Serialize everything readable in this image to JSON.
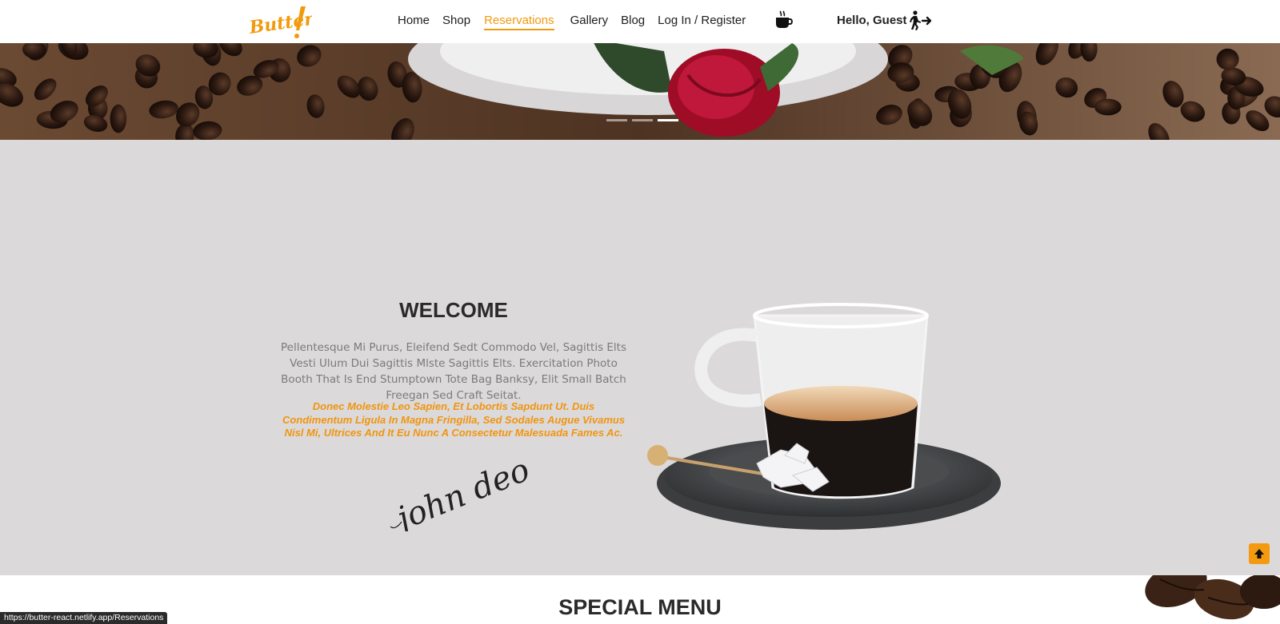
{
  "brand": {
    "logo_text": "Butter!",
    "accent_color": "#f29a0e"
  },
  "nav": {
    "items": [
      {
        "label": "Home",
        "active": false
      },
      {
        "label": "Shop",
        "active": false
      },
      {
        "label": "Reservations",
        "active": true
      },
      {
        "label": "Gallery",
        "active": false
      },
      {
        "label": "Blog",
        "active": false
      },
      {
        "label": "Log In / Register",
        "active": false
      }
    ],
    "cart_icon": "coffee-cup-icon",
    "greeting": "Hello, Guest",
    "logout_icon": "walking-exit-icon"
  },
  "hero": {
    "slides_total": 3,
    "active_slide": 3
  },
  "welcome": {
    "title": "WELCOME",
    "text": "Pellentesque Mi Purus, Eleifend Sedt Commodo Vel, Sagittis Elts Vesti Ulum Dui Sagittis Mlste Sagittis Elts. Exercitation Photo Booth That Is End Stumptown Tote Bag Banksy, Elit Small Batch Freegan Sed Craft Seitat.",
    "highlight": "Donec Molestie Leo Sapien, Et Lobortis Sapdunt Ut. Duis Condimentum Ligula In Magna Fringilla, Sed Sodales Augue Vivamus Nisl Mi, Ultrices And It Eu Nunc A Consectetur Malesuada Fames Ac.",
    "signature": "john deo"
  },
  "special_menu": {
    "title": "SPECIAL MENU"
  },
  "back_to_top_icon": "arrow-up-icon",
  "status_bar": {
    "url": "https://butter-react.netlify.app/Reservations"
  }
}
